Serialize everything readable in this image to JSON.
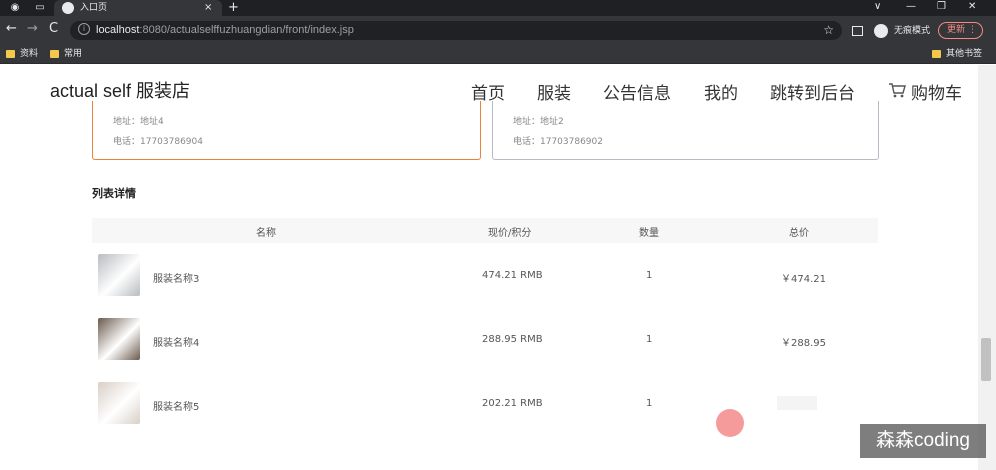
{
  "browser": {
    "tab_title": "入口页",
    "tab_close": "×",
    "new_tab": "+",
    "window_controls": [
      "∨",
      "—",
      "❐",
      "✕"
    ],
    "nav_back": "←",
    "nav_forward": "→",
    "nav_reload": "C",
    "url_host": "localhost",
    "url_rest": ":8080/actualselffuzhuangdian/front/index.jsp",
    "incognito_label": "无痕模式",
    "update_label": "更新",
    "update_more": "⋮",
    "bookmarks": [
      "资料",
      "常用"
    ],
    "other_bookmarks": "其他书签"
  },
  "header": {
    "brand": "actual self 服装店",
    "nav": [
      "首页",
      "服装",
      "公告信息",
      "我的",
      "跳转到后台",
      "购物车"
    ]
  },
  "address_cards": [
    {
      "address": "地址：地址4",
      "phone": "电话：17703786904",
      "border_color": "#e8823c"
    },
    {
      "address": "地址：地址2",
      "phone": "电话：17703786902",
      "border_color": "#b9b9c4"
    }
  ],
  "list": {
    "title": "列表详情",
    "columns": [
      "名称",
      "现价/积分",
      "数量",
      "总价"
    ],
    "rows": [
      {
        "name": "服装名称3",
        "price": "474.21 RMB",
        "qty": "1",
        "total": "￥474.21",
        "thumb_color": "#b8bcc0"
      },
      {
        "name": "服装名称4",
        "price": "288.95 RMB",
        "qty": "1",
        "total": "￥288.95",
        "thumb_color": "#6b5a4d"
      },
      {
        "name": "服装名称5",
        "price": "202.21 RMB",
        "qty": "1",
        "total": "",
        "thumb_color": "#d9cfc7"
      }
    ]
  },
  "watermark": "森森coding"
}
